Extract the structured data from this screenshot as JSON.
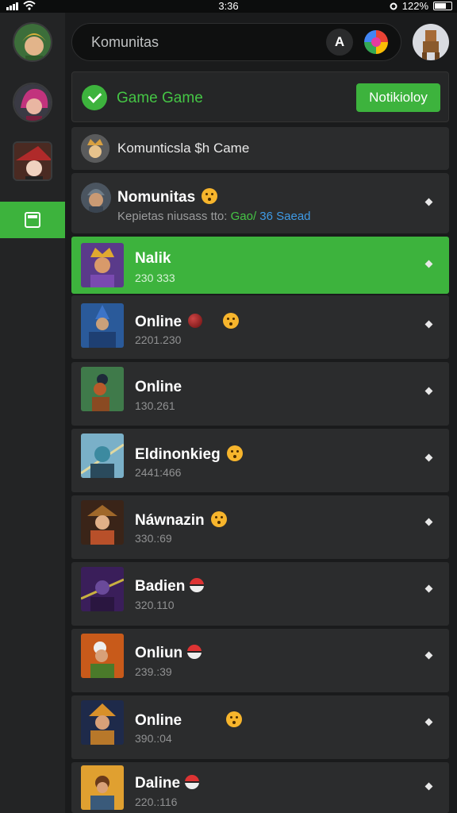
{
  "status": {
    "time": "3:36",
    "battery": "122%"
  },
  "search": {
    "placeholder": "Komunitas",
    "action_glyph": "A"
  },
  "sidebar": {
    "active_icon": "calendar-icon"
  },
  "game_bar": {
    "title": "Game Game",
    "button_label": "Notikioloy"
  },
  "community_header": {
    "title": "Komunticsla $h Came"
  },
  "community_info": {
    "title": "Nomunitas",
    "subtitle_prefix": "Kepietas niusass tto:",
    "subtitle_green": "Gao/",
    "subtitle_blue": "36 Saead"
  },
  "rows": [
    {
      "name": "Nalik",
      "count": "230 333",
      "active": true,
      "badge": ""
    },
    {
      "name": "Online",
      "count": "2201.230",
      "active": false,
      "badge": "red-emoji"
    },
    {
      "name": "Online",
      "count": "130.261",
      "active": false,
      "badge": ""
    },
    {
      "name": "Eldinonkieg",
      "count": "2441:466",
      "active": false,
      "badge": "emoji"
    },
    {
      "name": "Náwnazin",
      "count": "330.:69",
      "active": false,
      "badge": "emoji"
    },
    {
      "name": "Badien",
      "count": "320.110",
      "active": false,
      "badge": "ball"
    },
    {
      "name": "Onliun",
      "count": "239.:39",
      "active": false,
      "badge": "ball"
    },
    {
      "name": "Online",
      "count": "390.:04",
      "active": false,
      "badge": "emoji-far"
    },
    {
      "name": "Daline",
      "count": "220.:116",
      "active": false,
      "badge": "ball"
    }
  ],
  "colors": {
    "accent": "#3db33d",
    "panel": "#2b2c2d",
    "background": "#1a1b1c"
  }
}
